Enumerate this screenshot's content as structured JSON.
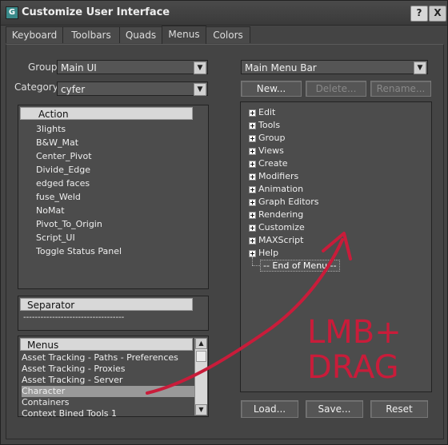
{
  "window": {
    "title": "Customize User Interface",
    "app_icon_letter": "G",
    "help_label": "?",
    "close_label": "X"
  },
  "tabs": [
    "Keyboard",
    "Toolbars",
    "Quads",
    "Menus",
    "Colors"
  ],
  "active_tab": "Menus",
  "left": {
    "group_label": "Group:",
    "group_value": "Main UI",
    "category_label": "Category:",
    "category_value": "cyfer",
    "action_header": "Action",
    "actions": [
      "3lights",
      "B&W_Mat",
      "Center_Pivot",
      "Divide_Edge",
      "edged faces",
      "fuse_Weld",
      "NoMat",
      "Pivot_To_Origin",
      "Script_UI",
      "Toggle Status Panel"
    ],
    "separator_header": "Separator",
    "separator_item": "-----------------------------------",
    "menus_header": "Menus",
    "menus": [
      "Asset Tracking - Paths - Preferences",
      "Asset Tracking - Proxies",
      "Asset Tracking - Server",
      "Character",
      "Containers",
      "Context Bined Tools 1"
    ],
    "selected_menu": "Character"
  },
  "right": {
    "menu_bar_value": "Main Menu Bar",
    "new_label": "New...",
    "delete_label": "Delete...",
    "rename_label": "Rename...",
    "menu_items": [
      "Edit",
      "Tools",
      "Group",
      "Views",
      "Create",
      "Modifiers",
      "Animation",
      "Graph Editors",
      "Rendering",
      "Customize",
      "MAXScript",
      "Help"
    ],
    "end_of_menu": "-- End of Menu --",
    "load_label": "Load...",
    "save_label": "Save...",
    "reset_label": "Reset"
  },
  "annotation": {
    "line1": "LMB+",
    "line2": "DRAG",
    "color": "#c91c3a"
  }
}
